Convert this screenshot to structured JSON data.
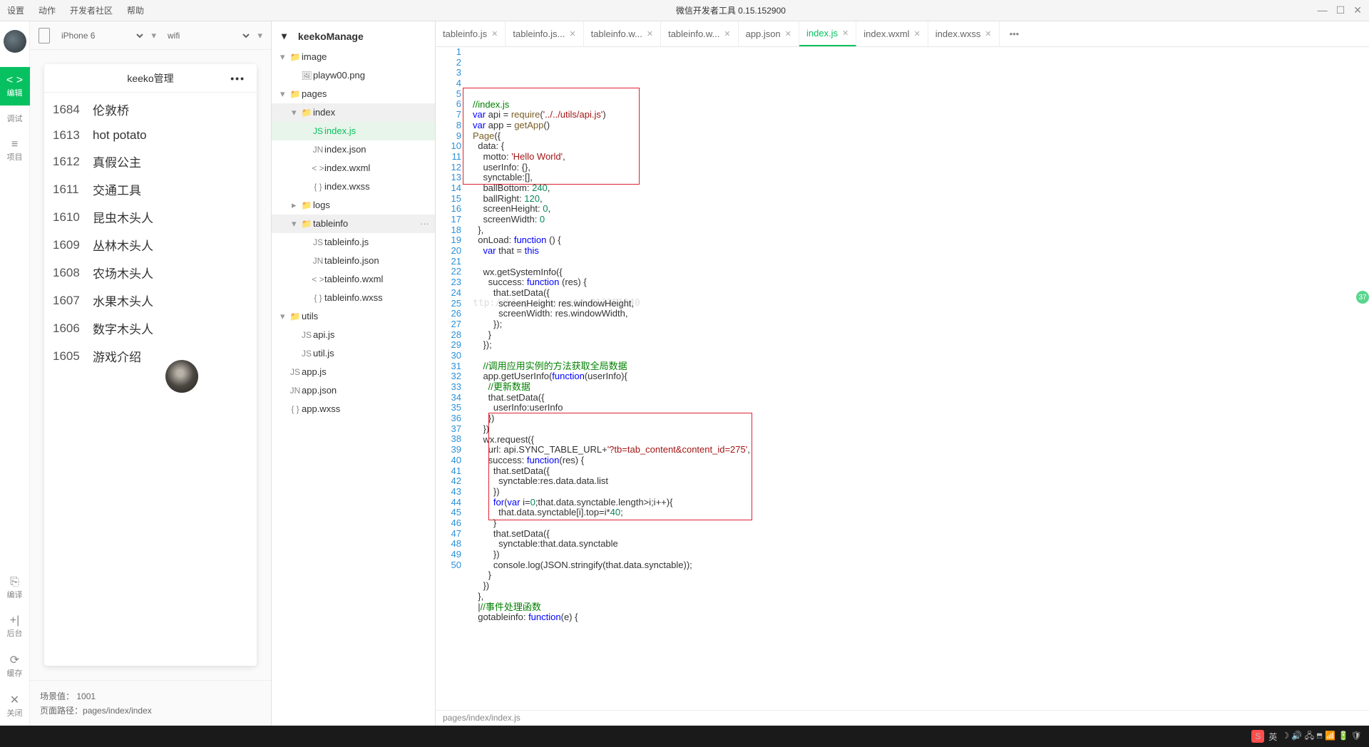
{
  "titlebar": {
    "menus": [
      "设置",
      "动作",
      "开发者社区",
      "帮助"
    ],
    "center": "微信开发者工具 0.15.152900"
  },
  "activity": [
    {
      "icon": "< >",
      "label": "编辑",
      "active": true
    },
    {
      "icon": "</>",
      "label": "调试"
    },
    {
      "icon": "≡",
      "label": "项目"
    }
  ],
  "activity_bottom": [
    {
      "icon": "⎘",
      "label": "编译"
    },
    {
      "icon": "+|",
      "label": "后台"
    },
    {
      "icon": "⟳",
      "label": "缓存"
    },
    {
      "icon": "✕",
      "label": "关闭"
    }
  ],
  "sim": {
    "device": "iPhone 6",
    "network": "wifi",
    "title": "keeko管理",
    "list": [
      {
        "id": "1684",
        "name": "伦敦桥"
      },
      {
        "id": "1613",
        "name": "hot potato"
      },
      {
        "id": "1612",
        "name": "真假公主"
      },
      {
        "id": "1611",
        "name": "交通工具"
      },
      {
        "id": "1610",
        "name": "昆虫木头人"
      },
      {
        "id": "1609",
        "name": "丛林木头人"
      },
      {
        "id": "1608",
        "name": "农场木头人"
      },
      {
        "id": "1607",
        "name": "水果木头人"
      },
      {
        "id": "1606",
        "name": "数字木头人"
      },
      {
        "id": "1605",
        "name": "游戏介绍"
      }
    ],
    "scene_label": "场景值：",
    "scene": "1001",
    "route_label": "页面路径：",
    "route": "pages/index/index"
  },
  "project": "keekoManage",
  "tree": [
    {
      "d": 1,
      "caret": "▾",
      "icon": "📁",
      "name": "image"
    },
    {
      "d": 2,
      "caret": "",
      "icon": "🖼",
      "name": "playw00.png"
    },
    {
      "d": 1,
      "caret": "▾",
      "icon": "📁",
      "name": "pages"
    },
    {
      "d": 2,
      "caret": "▾",
      "icon": "📁",
      "name": "index",
      "hl": true
    },
    {
      "d": 3,
      "caret": "",
      "icon": "JS",
      "name": "index.js",
      "sel": true
    },
    {
      "d": 3,
      "caret": "",
      "icon": "JN",
      "name": "index.json"
    },
    {
      "d": 3,
      "caret": "",
      "icon": "< >",
      "name": "index.wxml"
    },
    {
      "d": 3,
      "caret": "",
      "icon": "{ }",
      "name": "index.wxss"
    },
    {
      "d": 2,
      "caret": "▸",
      "icon": "📁",
      "name": "logs"
    },
    {
      "d": 2,
      "caret": "▾",
      "icon": "📁",
      "name": "tableinfo",
      "hl": true,
      "more": "···"
    },
    {
      "d": 3,
      "caret": "",
      "icon": "JS",
      "name": "tableinfo.js"
    },
    {
      "d": 3,
      "caret": "",
      "icon": "JN",
      "name": "tableinfo.json"
    },
    {
      "d": 3,
      "caret": "",
      "icon": "< >",
      "name": "tableinfo.wxml"
    },
    {
      "d": 3,
      "caret": "",
      "icon": "{ }",
      "name": "tableinfo.wxss"
    },
    {
      "d": 1,
      "caret": "▾",
      "icon": "📁",
      "name": "utils"
    },
    {
      "d": 2,
      "caret": "",
      "icon": "JS",
      "name": "api.js"
    },
    {
      "d": 2,
      "caret": "",
      "icon": "JS",
      "name": "util.js"
    },
    {
      "d": 1,
      "caret": "",
      "icon": "JS",
      "name": "app.js"
    },
    {
      "d": 1,
      "caret": "",
      "icon": "JN",
      "name": "app.json"
    },
    {
      "d": 1,
      "caret": "",
      "icon": "{ }",
      "name": "app.wxss"
    }
  ],
  "tabs": [
    {
      "label": "tableinfo.js",
      "close": true
    },
    {
      "label": "tableinfo.js...",
      "close": true
    },
    {
      "label": "tableinfo.w...",
      "close": true
    },
    {
      "label": "tableinfo.w...",
      "close": true
    },
    {
      "label": "app.json",
      "close": true
    },
    {
      "label": "index.js",
      "close": true,
      "active": true
    },
    {
      "label": "index.wxml",
      "close": true
    },
    {
      "label": "index.wxss",
      "close": true
    }
  ],
  "breadcrumb": "pages/index/index.js",
  "watermark": "ttp://blog.csdn.net/u013351340",
  "code": [
    {
      "n": 1,
      "h": "<span class='c-cm'>//index.js</span>"
    },
    {
      "n": 2,
      "h": "<span class='c-kw'>var</span> api = <span class='c-fn'>require</span>(<span class='c-str'>'../../utils/api.js'</span>)"
    },
    {
      "n": 3,
      "h": "<span class='c-kw'>var</span> app = <span class='c-fn'>getApp</span>()"
    },
    {
      "n": 4,
      "h": "<span class='c-fn'>Page</span>({"
    },
    {
      "n": 5,
      "h": "  data: {"
    },
    {
      "n": 6,
      "h": "    motto: <span class='c-str'>'Hello World'</span>,"
    },
    {
      "n": 7,
      "h": "    userInfo: {},"
    },
    {
      "n": 8,
      "h": "    synctable:[],"
    },
    {
      "n": 9,
      "h": "    ballBottom: <span class='c-num'>240</span>,"
    },
    {
      "n": 10,
      "h": "    ballRight: <span class='c-num'>120</span>,"
    },
    {
      "n": 11,
      "h": "    screenHeight: <span class='c-num'>0</span>,"
    },
    {
      "n": 12,
      "h": "    screenWidth: <span class='c-num'>0</span>"
    },
    {
      "n": 13,
      "h": "  },"
    },
    {
      "n": 14,
      "h": "  onLoad: <span class='c-kw'>function</span> () {"
    },
    {
      "n": 15,
      "h": "    <span class='c-kw'>var</span> that = <span class='c-kw'>this</span>"
    },
    {
      "n": 16,
      "h": ""
    },
    {
      "n": 17,
      "h": "    wx.getSystemInfo({"
    },
    {
      "n": 18,
      "h": "      success: <span class='c-kw'>function</span> (res) {"
    },
    {
      "n": 19,
      "h": "        that.setData({"
    },
    {
      "n": 20,
      "h": "          screenHeight: res.windowHeight,"
    },
    {
      "n": 21,
      "h": "          screenWidth: res.windowWidth,"
    },
    {
      "n": 22,
      "h": "        });"
    },
    {
      "n": 23,
      "h": "      }"
    },
    {
      "n": 24,
      "h": "    });"
    },
    {
      "n": 25,
      "h": ""
    },
    {
      "n": 26,
      "h": "    <span class='c-cm'>//调用应用实例的方法获取全局数据</span>"
    },
    {
      "n": 27,
      "h": "    app.getUserInfo(<span class='c-kw'>function</span>(userInfo){"
    },
    {
      "n": 28,
      "h": "      <span class='c-cm'>//更新数据</span>"
    },
    {
      "n": 29,
      "h": "      that.setData({"
    },
    {
      "n": 30,
      "h": "        userInfo:userInfo"
    },
    {
      "n": 31,
      "h": "      })"
    },
    {
      "n": 32,
      "h": "    })"
    },
    {
      "n": 33,
      "h": "    wx.request({"
    },
    {
      "n": 34,
      "h": "      url: api.SYNC_TABLE_URL+<span class='c-str'>'?tb=tab_content&content_id=275'</span>,"
    },
    {
      "n": 35,
      "h": "      success: <span class='c-kw'>function</span>(res) {"
    },
    {
      "n": 36,
      "h": "        that.setData({"
    },
    {
      "n": 37,
      "h": "          synctable:res.data.data.list"
    },
    {
      "n": 38,
      "h": "        })"
    },
    {
      "n": 39,
      "h": "        <span class='c-kw'>for</span>(<span class='c-kw'>var</span> i=<span class='c-num'>0</span>;that.data.synctable.length>i;i++){"
    },
    {
      "n": 40,
      "h": "          that.data.synctable[i].top=i*<span class='c-num'>40</span>;"
    },
    {
      "n": 41,
      "h": "        }"
    },
    {
      "n": 42,
      "h": "        that.setData({"
    },
    {
      "n": 43,
      "h": "          synctable:that.data.synctable"
    },
    {
      "n": 44,
      "h": "        })"
    },
    {
      "n": 45,
      "h": "        console.log(JSON.stringify(that.data.synctable));"
    },
    {
      "n": 46,
      "h": "      }"
    },
    {
      "n": 47,
      "h": "    })"
    },
    {
      "n": 48,
      "h": "  },"
    },
    {
      "n": 49,
      "h": "  |<span class='c-cm'>//事件处理函数</span>"
    },
    {
      "n": 50,
      "h": "  gotableinfo: <span class='c-kw'>function</span>(e) {"
    }
  ],
  "badge": "37",
  "tray": {
    "ime": "S",
    "lang": "英",
    "icons": [
      "☽",
      "🔊",
      "🖧",
      "⬒",
      "📶",
      "🔋",
      "🛡"
    ]
  }
}
